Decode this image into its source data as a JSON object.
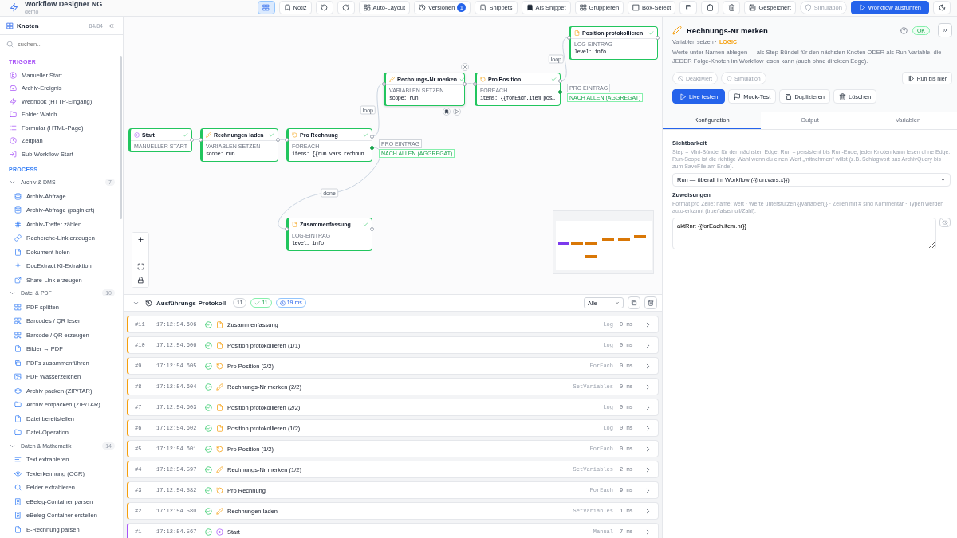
{
  "app": {
    "title": "Workflow Designer NG",
    "subtitle": "demo"
  },
  "toolbar": [
    {
      "kind": "icon",
      "selected": true
    },
    {
      "kind": "plain",
      "label": "Notiz",
      "selected": false
    },
    {
      "kind": "icon",
      "selected": false
    },
    {
      "kind": "icon",
      "selected": false
    },
    {
      "kind": "plain",
      "label": "Auto-Layout",
      "selected": false
    },
    {
      "kind": "plain",
      "label": "Versionen",
      "badge": "1",
      "selected": false
    },
    {
      "kind": "plain",
      "label": "Snippets",
      "selected": false
    },
    {
      "kind": "plain",
      "label": "Als Snippet",
      "selected": false
    },
    {
      "kind": "plain",
      "label": "Gruppieren",
      "selected": false
    },
    {
      "kind": "plain",
      "label": "Box-Select",
      "selected": false
    },
    {
      "kind": "icon",
      "selected": false
    },
    {
      "kind": "icon",
      "selected": false
    },
    {
      "kind": "icon",
      "selected": false
    },
    {
      "kind": "plain",
      "label": "Gespeichert",
      "selected": false
    },
    {
      "kind": "pill",
      "label": "Simulation",
      "selected": false
    },
    {
      "kind": "primary",
      "label": "Workflow ausführen",
      "selected": false
    },
    {
      "kind": "icon",
      "selected": false
    }
  ],
  "sidebar": {
    "title": "Knoten",
    "count": "84/84",
    "search": {
      "placeholder": "suchen..."
    },
    "sections": [
      {
        "title": "TRIGGER",
        "color": "#a855f7",
        "items": [
          "Manueller Start",
          "Archiv-Ereignis",
          "Webhook (HTTP-Eingang)",
          "Folder Watch",
          "Formular (HTML-Page)",
          "Zeitplan",
          "Sub-Workflow-Start"
        ]
      },
      {
        "title": "PROCESS",
        "color": "#3b82f6",
        "groups": [
          {
            "title": "Archiv & DMS",
            "count": "7",
            "expanded": true,
            "items": [
              "Archiv-Abfrage",
              "Archiv-Abfrage (paginiert)",
              "Archiv-Treffer zählen",
              "Recherche-Link erzeugen",
              "Dokument holen",
              "DocExtract KI-Extraktion",
              "Share-Link erzeugen"
            ]
          },
          {
            "title": "Datei & PDF",
            "count": "10",
            "expanded": true,
            "items": [
              "PDF splitten",
              "Barcodes / QR lesen",
              "Barcode / QR erzeugen",
              "Bilder → PDF",
              "PDFs zusammenführen",
              "PDF Wasserzeichen",
              "Archiv packen (ZIP/TAR)",
              "Archiv entpacken (ZIP/TAR)",
              "Datei bereitstellen",
              "Datei-Operation"
            ]
          },
          {
            "title": "Daten & Mathematik",
            "count": "14",
            "expanded": true,
            "items": [
              "Text extrahieren",
              "Texterkennung (OCR)",
              "Felder extrahieren",
              "eBeleg-Container parsen",
              "eBeleg-Container erstellen",
              "E-Rechnung parsen"
            ]
          }
        ]
      }
    ]
  },
  "canvas": {
    "nodes": [
      {
        "kind": "log",
        "title": "Position protokollieren",
        "type": "LOG-EINTRAG",
        "detail": "level: info",
        "done": true,
        "selected": false
      },
      {
        "kind": "setvars",
        "title": "Rechnungs-Nr merken",
        "type": "VARIABLEN SETZEN",
        "detail": "scope: run",
        "done": true,
        "selected": true
      },
      {
        "kind": "foreach",
        "title": "Pro Position",
        "type": "FOREACH",
        "detail": "items: {{forEach.item.pos…",
        "ports": [
          "PRO EINTRAG",
          "NACH ALLEN (AGGREGAT)"
        ],
        "done": true,
        "selected": false
      },
      {
        "kind": "manual",
        "title": "Start",
        "type": "MANUELLER START",
        "done": true,
        "selected": false
      },
      {
        "kind": "setvars",
        "title": "Rechnungen laden",
        "type": "VARIABLEN SETZEN",
        "detail": "scope: run",
        "done": true,
        "selected": false
      },
      {
        "kind": "foreach",
        "title": "Pro Rechnung",
        "type": "FOREACH",
        "detail": "items: {{run.vars.rechnun…",
        "ports": [
          "PRO EINTRAG",
          "NACH ALLEN (AGGREGAT)"
        ],
        "done": true,
        "selected": false
      },
      {
        "kind": "log",
        "title": "Zusammenfassung",
        "type": "LOG-EINTRAG",
        "detail": "level: info",
        "done": true,
        "selected": false
      }
    ],
    "edge_labels": [
      "loop",
      "loop",
      "done"
    ]
  },
  "log": {
    "expanded": true,
    "title": "Ausführungs-Protokoll",
    "total": "11",
    "ok": "11",
    "duration": "19 ms",
    "filter": "Alle",
    "rows": [
      {
        "n": "#11",
        "time": "17:12:54.606",
        "kind": "log",
        "title": "Zusammenfassung",
        "type": "Log",
        "duration": "0 ms",
        "ok": true
      },
      {
        "n": "#10",
        "time": "17:12:54.606",
        "kind": "log",
        "title": "Position protokollieren (1/1)",
        "type": "Log",
        "duration": "0 ms",
        "ok": true
      },
      {
        "n": "#9",
        "time": "17:12:54.605",
        "kind": "foreach",
        "title": "Pro Position (2/2)",
        "type": "ForEach",
        "duration": "0 ms",
        "ok": true
      },
      {
        "n": "#8",
        "time": "17:12:54.604",
        "kind": "setvars",
        "title": "Rechnungs-Nr merken (2/2)",
        "type": "SetVariables",
        "duration": "0 ms",
        "ok": true
      },
      {
        "n": "#7",
        "time": "17:12:54.603",
        "kind": "log",
        "title": "Position protokollieren (2/2)",
        "type": "Log",
        "duration": "0 ms",
        "ok": true
      },
      {
        "n": "#6",
        "time": "17:12:54.602",
        "kind": "log",
        "title": "Position protokollieren (1/2)",
        "type": "Log",
        "duration": "0 ms",
        "ok": true
      },
      {
        "n": "#5",
        "time": "17:12:54.601",
        "kind": "foreach",
        "title": "Pro Position (1/2)",
        "type": "ForEach",
        "duration": "0 ms",
        "ok": true
      },
      {
        "n": "#4",
        "time": "17:12:54.597",
        "kind": "setvars",
        "title": "Rechnungs-Nr merken (1/2)",
        "type": "SetVariables",
        "duration": "2 ms",
        "ok": true
      },
      {
        "n": "#3",
        "time": "17:12:54.582",
        "kind": "foreach",
        "title": "Pro Rechnung",
        "type": "ForEach",
        "duration": "9 ms",
        "ok": true
      },
      {
        "n": "#2",
        "time": "17:12:54.580",
        "kind": "setvars",
        "title": "Rechnungen laden",
        "type": "SetVariables",
        "duration": "1 ms",
        "ok": true
      },
      {
        "n": "#1",
        "time": "17:12:54.567",
        "kind": "manual",
        "title": "Start",
        "type": "Manual",
        "duration": "7 ms",
        "ok": true
      }
    ]
  },
  "inspector": {
    "title": "Rechnungs-Nr merken",
    "type": "Variablen setzen ·",
    "category": "LOGIC",
    "status": "OK",
    "description": "Werte unter Namen ablegen — als Step-Bündel für den nächsten Knoten ODER als Run-Variable, die JEDER Folge-Knoten im Workflow lesen kann (auch ohne direkten Edge).",
    "toggles": [
      {
        "label": "Deaktiviert",
        "on": false
      },
      {
        "label": "Simulation",
        "on": false
      }
    ],
    "run_to": "Run bis hier",
    "actions": [
      {
        "label": "Live testen",
        "kind": "primary"
      },
      {
        "label": "Mock-Test",
        "kind": "plain"
      },
      {
        "label": "Duplizieren",
        "kind": "plain"
      },
      {
        "label": "Löschen",
        "kind": "plain"
      }
    ],
    "tabs": [
      {
        "label": "Konfiguration",
        "selected": true
      },
      {
        "label": "Output",
        "selected": false
      },
      {
        "label": "Variablen",
        "selected": false
      }
    ],
    "visibility": {
      "label": "Sichtbarkeit",
      "hint": "Step = Mini-Bündel für den nächsten Edge. Run = persistent bis Run-Ende, jeder Knoten kann lesen ohne Edge. Run-Scope ist die richtige Wahl wenn du einen Wert „mitnehmen“ willst (z.B. Schlagwort aus ArchivQuery bis zum SaveFile am Ende).",
      "value": "Run — überall im Workflow ({{run.vars.x}})"
    },
    "assignments": {
      "label": "Zuweisungen",
      "hint": "Format pro Zeile: name: wert · Werte unterstützen {{variablen}} · Zeilen mit # sind Kommentar · Typen werden auto-erkannt (true/false/null/Zahl).",
      "value": "aktRnr: {{forEach.item.nr}}"
    }
  }
}
